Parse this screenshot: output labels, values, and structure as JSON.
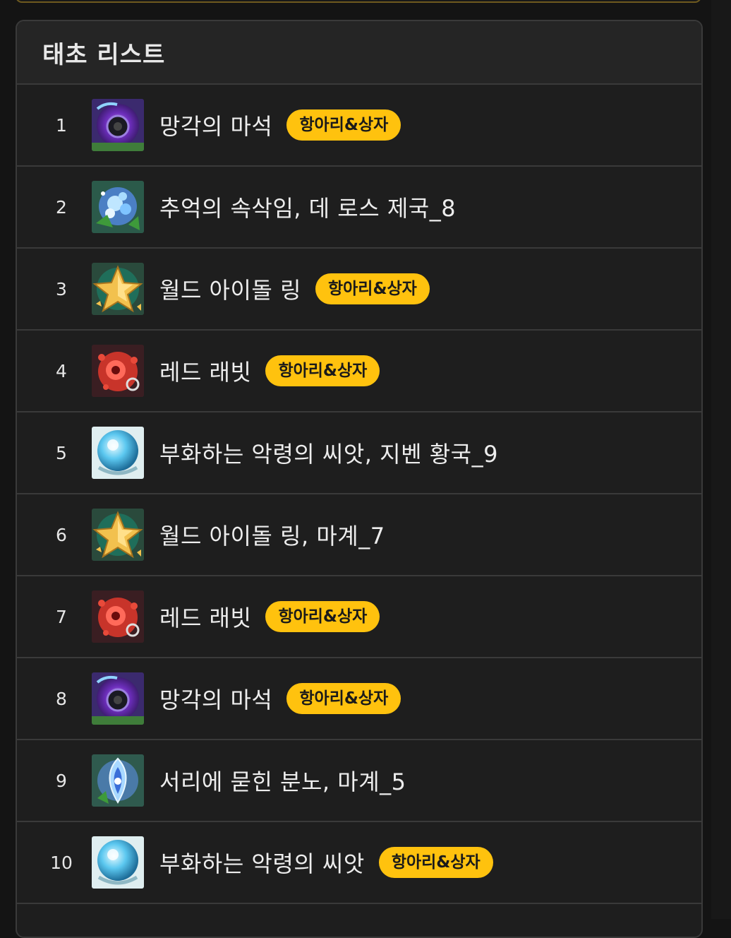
{
  "panel": {
    "title": "태초 리스트"
  },
  "rows": [
    {
      "rank": "1",
      "icon": "black-orb-icon",
      "name": "망각의 마석",
      "badge": "항아리&상자"
    },
    {
      "rank": "2",
      "icon": "blue-flower-icon",
      "name": "추억의 속삭임, 데 로스 제국_8",
      "badge": ""
    },
    {
      "rank": "3",
      "icon": "gold-star-icon",
      "name": "월드 아이돌 링",
      "badge": "항아리&상자"
    },
    {
      "rank": "4",
      "icon": "red-rabbit-icon",
      "name": "레드 래빗",
      "badge": "항아리&상자"
    },
    {
      "rank": "5",
      "icon": "crystal-orb-icon",
      "name": "부화하는 악령의 씨앗, 지벤 황국_9",
      "badge": ""
    },
    {
      "rank": "6",
      "icon": "gold-star-icon",
      "name": "월드 아이돌 링, 마계_7",
      "badge": ""
    },
    {
      "rank": "7",
      "icon": "red-rabbit-icon",
      "name": "레드 래빗",
      "badge": "항아리&상자"
    },
    {
      "rank": "8",
      "icon": "black-orb-icon",
      "name": "망각의 마석",
      "badge": "항아리&상자"
    },
    {
      "rank": "9",
      "icon": "frost-gem-icon",
      "name": "서리에 묻힌 분노, 마계_5",
      "badge": ""
    },
    {
      "rank": "10",
      "icon": "crystal-orb-icon",
      "name": "부화하는 악령의 씨앗",
      "badge": "항아리&상자"
    }
  ],
  "colors": {
    "badge_bg": "#ffc20e",
    "panel_bg": "#1e1e1e",
    "header_bg": "#252525",
    "divider": "#3a3a3a"
  }
}
